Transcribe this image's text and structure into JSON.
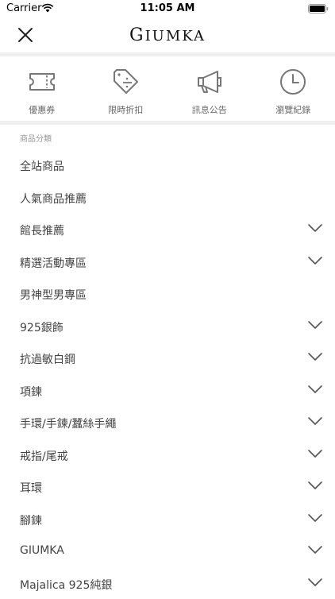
{
  "status_bar": {
    "carrier": "Carrier",
    "time": "11:05 AM"
  },
  "header": {
    "brand_first": "G",
    "brand_rest": "IUMKA"
  },
  "quick_actions": [
    {
      "label": "優惠券",
      "icon": "ticket-icon"
    },
    {
      "label": "限時折扣",
      "icon": "discount-tag-icon"
    },
    {
      "label": "訊息公告",
      "icon": "megaphone-icon"
    },
    {
      "label": "瀏覽紀錄",
      "icon": "clock-icon"
    }
  ],
  "section": {
    "title": "商品分類"
  },
  "categories": [
    {
      "label": "全站商品",
      "expandable": false
    },
    {
      "label": "人氣商品推薦",
      "expandable": false
    },
    {
      "label": "館長推薦",
      "expandable": true
    },
    {
      "label": "精選活動專區",
      "expandable": true
    },
    {
      "label": "男神型男專區",
      "expandable": false
    },
    {
      "label": "925銀飾",
      "expandable": true
    },
    {
      "label": "抗過敏白鋼",
      "expandable": true
    },
    {
      "label": "項鍊",
      "expandable": true
    },
    {
      "label": "手環/手鍊/蠶絲手繩",
      "expandable": true
    },
    {
      "label": "戒指/尾戒",
      "expandable": true
    },
    {
      "label": "耳環",
      "expandable": true
    },
    {
      "label": "腳鍊",
      "expandable": true
    },
    {
      "label": "GIUMKA",
      "expandable": true
    },
    {
      "label": "Majalica 925純銀",
      "expandable": true
    }
  ]
}
